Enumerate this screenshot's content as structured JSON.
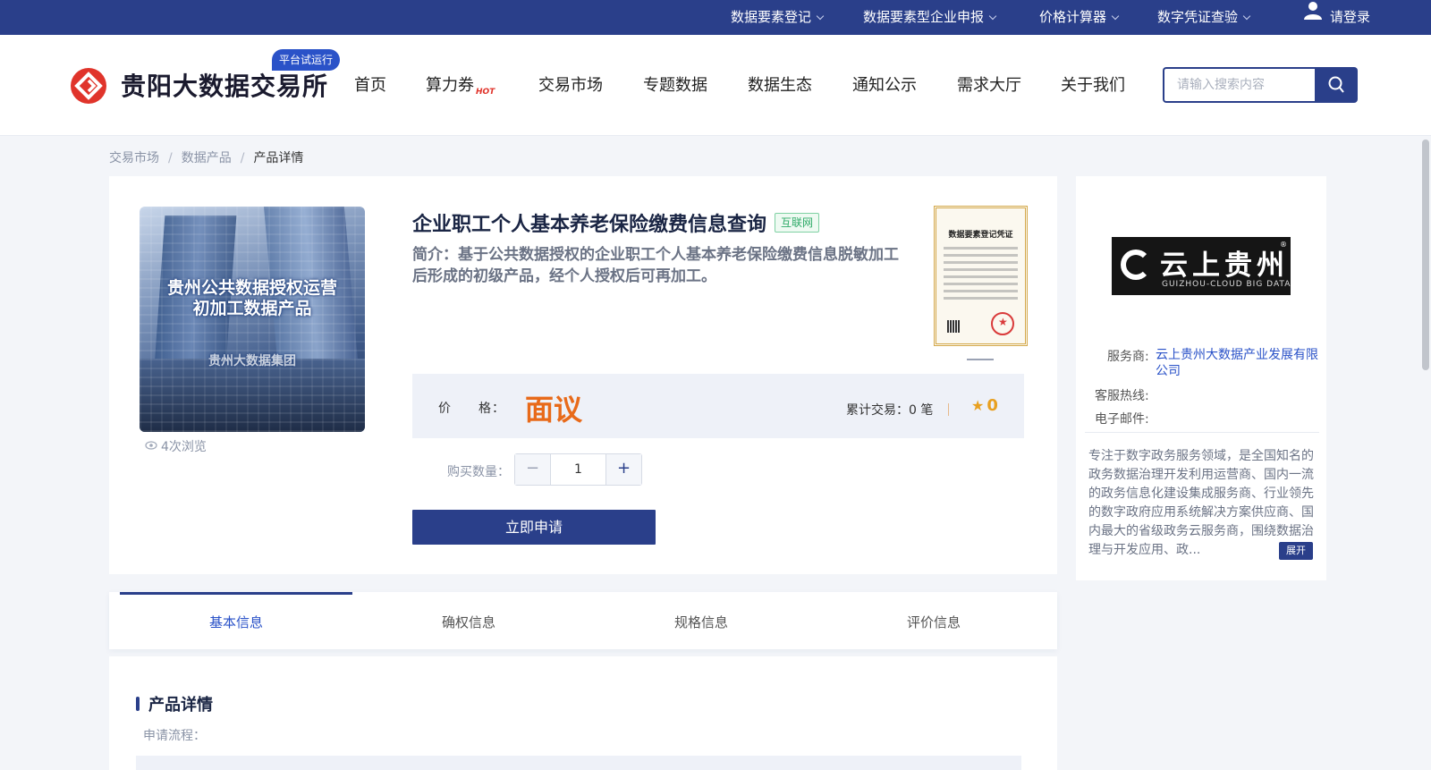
{
  "topbar": {
    "items": [
      {
        "label": "数据要素登记"
      },
      {
        "label": "数据要素型企业申报"
      },
      {
        "label": "价格计算器"
      },
      {
        "label": "数字凭证查验"
      }
    ],
    "login_label": "请登录"
  },
  "header": {
    "logo_text": "贵阳大数据交易所",
    "trial_badge": "平台试运行",
    "nav": [
      {
        "label": "首页"
      },
      {
        "label": "算力券",
        "badge": "HOT"
      },
      {
        "label": "交易市场"
      },
      {
        "label": "专题数据"
      },
      {
        "label": "数据生态"
      },
      {
        "label": "通知公示"
      },
      {
        "label": "需求大厅"
      },
      {
        "label": "关于我们"
      }
    ],
    "search": {
      "placeholder": "请输入搜索内容",
      "value": ""
    }
  },
  "breadcrumb": {
    "items": [
      "交易市场",
      "数据产品",
      "产品详情"
    ],
    "separator": "/"
  },
  "product": {
    "image_text_line1": "贵州公共数据授权运营",
    "image_text_line2": "初加工数据产品",
    "image_caption": "贵州大数据集团",
    "view_count": "4次浏览",
    "title": "企业职工个人基本养老保险缴费信息查询",
    "tag": "互联网",
    "description": "简介：基于公共数据授权的企业职工个人基本养老保险缴费信息脱敏加工后形成的初级产品，经个人授权后可再加工。",
    "certificate_title": "数据要素登记凭证",
    "price_label": "价　　格：",
    "price_value": "面议",
    "trade_count": "累计交易：0 笔",
    "rating": "0",
    "qty_label": "购买数量：",
    "qty_value": "1",
    "apply_label": "立即申请"
  },
  "vendor": {
    "logo_name": "云上贵州",
    "logo_sub": "GUIZHOU-CLOUD BIG DATA",
    "provider_label": "服务商:",
    "provider_value": "云上贵州大数据产业发展有限公司",
    "hotline_label": "客服热线:",
    "hotline_value": "",
    "email_label": "电子邮件:",
    "email_value": "",
    "description": "专注于数字政务服务领域，是全国知名的政务数据治理开发利用运营商、国内一流的政务信息化建设集成服务商、行业领先的数字政府应用系统解决方案供应商、国内最大的省级政务云服务商，围绕数据治理与开发应用、政...",
    "expand_label": "展开"
  },
  "tabs": {
    "items": [
      {
        "label": "基本信息",
        "active": true
      },
      {
        "label": "确权信息"
      },
      {
        "label": "规格信息"
      },
      {
        "label": "评价信息"
      }
    ]
  },
  "details": {
    "section_title": "产品详情",
    "flow_label": "申请流程："
  },
  "colors": {
    "primary": "#2a3f8a",
    "accent_price": "#e86a1a",
    "link": "#2a52c8",
    "tag_green": "#2eaa68",
    "star": "#e8a020"
  }
}
